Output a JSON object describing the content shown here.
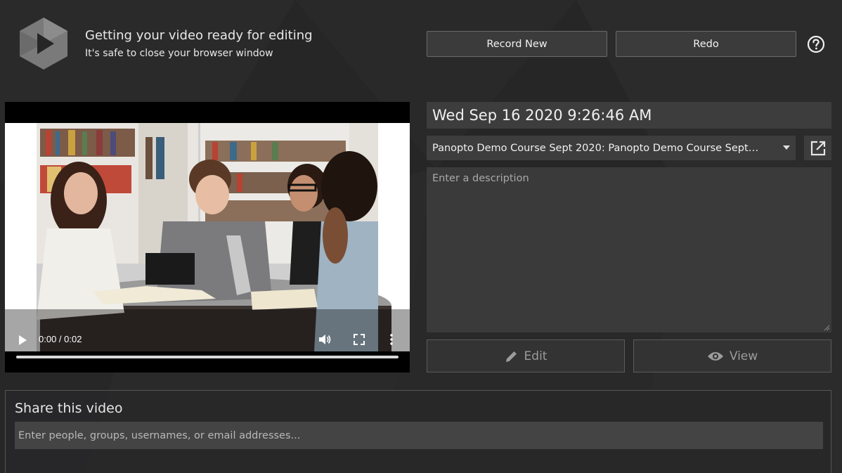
{
  "header": {
    "title": "Getting your video ready for editing",
    "subtitle": "It's safe to close your browser window",
    "logo_icon": "panopto-logo-icon",
    "help_icon": "help-question-icon"
  },
  "toolbar": {
    "record_new_label": "Record New",
    "redo_label": "Redo"
  },
  "video": {
    "time": "0:00 / 0:02",
    "controls": [
      "play-icon",
      "volume-icon",
      "fullscreen-icon",
      "more-menu-icon"
    ],
    "progress": 0
  },
  "session": {
    "title": "Wed Sep 16 2020 9:26:46 AM",
    "folder": "Panopto Demo Course Sept 2020: Panopto Demo Course Sept 2...",
    "description_placeholder": "Enter a description"
  },
  "actions": {
    "edit_label": "Edit",
    "view_label": "View"
  },
  "share": {
    "title": "Share this video",
    "placeholder": "Enter people, groups, usernames, or email addresses..."
  },
  "colors": {
    "background": "#262627",
    "field": "#3d3d3e",
    "button": "#3b3b3c",
    "disabled_text": "#9c9c9c"
  }
}
